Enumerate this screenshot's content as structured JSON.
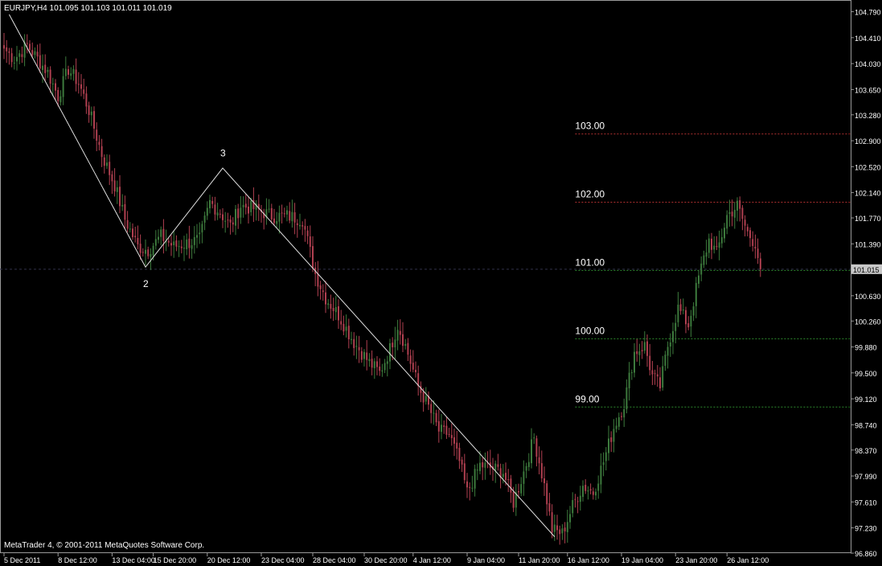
{
  "window": {
    "symbol_header": "EURJPY,H4  101.095 101.103 101.011 101.019",
    "copyright": "MetaTrader 4, © 2001-2011 MetaQuotes Software Corp."
  },
  "colors": {
    "background": "#000000",
    "frame": "#9a9a9a",
    "bull": "#3d7a3d",
    "bear": "#b04050",
    "text": "#ffffff",
    "level_red": "#b03030",
    "level_green": "#2e8b2e",
    "grid_dash": "#30304a",
    "price_tag_bg": "#c8c8c8",
    "zigzag": "#e0e0e0"
  },
  "chart_data": {
    "type": "candlestick",
    "timeframe": "H4",
    "symbol": "EURJPY",
    "ylim": [
      96.86,
      104.95
    ],
    "y_ticks": [
      "104.790",
      "104.410",
      "104.030",
      "103.650",
      "103.280",
      "102.900",
      "102.520",
      "102.140",
      "101.770",
      "101.390",
      "101.015",
      "100.630",
      "100.260",
      "99.880",
      "99.500",
      "99.120",
      "98.740",
      "98.370",
      "97.990",
      "97.610",
      "97.230",
      "96.860"
    ],
    "x_ticks": [
      {
        "label": "5 Dec 2011",
        "i": 0
      },
      {
        "label": "8 Dec 12:00",
        "i": 21
      },
      {
        "label": "13 Dec 04:00",
        "i": 42
      },
      {
        "label": "15 Dec 20:00",
        "i": 58
      },
      {
        "label": "20 Dec 12:00",
        "i": 79
      },
      {
        "label": "23 Dec 04:00",
        "i": 100
      },
      {
        "label": "28 Dec 04:00",
        "i": 120
      },
      {
        "label": "30 Dec 20:00",
        "i": 140
      },
      {
        "label": "4 Jan 12:00",
        "i": 159
      },
      {
        "label": "9 Jan 04:00",
        "i": 180
      },
      {
        "label": "11 Jan 20:00",
        "i": 200
      },
      {
        "label": "16 Jan 12:00",
        "i": 219
      },
      {
        "label": "19 Jan 04:00",
        "i": 240
      },
      {
        "label": "23 Jan 20:00",
        "i": 261
      },
      {
        "label": "26 Jan 12:00",
        "i": 281
      }
    ],
    "last_price": "101.015",
    "last_price_value": 101.019,
    "levels": [
      {
        "label": "103.00",
        "value": 103.0,
        "color": "red"
      },
      {
        "label": "102.00",
        "value": 102.0,
        "color": "red"
      },
      {
        "label": "101.00",
        "value": 101.0,
        "color": "green"
      },
      {
        "label": "100.00",
        "value": 100.0,
        "color": "green"
      },
      {
        "label": "99.00",
        "value": 99.0,
        "color": "green"
      }
    ],
    "levels_start_index": 222,
    "zigzag": [
      {
        "i": 2,
        "price": 104.75
      },
      {
        "i": 55,
        "price": 101.05
      },
      {
        "i": 85,
        "price": 102.5
      },
      {
        "i": 214,
        "price": 97.1
      }
    ],
    "wave_labels": [
      {
        "text": "2",
        "i": 55,
        "price": 100.85,
        "pos": "below"
      },
      {
        "text": "3",
        "i": 85,
        "price": 102.6,
        "pos": "above"
      }
    ],
    "anchors": [
      {
        "i": 0,
        "p": 104.25
      },
      {
        "i": 4,
        "p": 104.1
      },
      {
        "i": 9,
        "p": 104.3
      },
      {
        "i": 11,
        "p": 104.2
      },
      {
        "i": 17,
        "p": 103.9
      },
      {
        "i": 21,
        "p": 103.55
      },
      {
        "i": 25,
        "p": 103.95
      },
      {
        "i": 29,
        "p": 103.75
      },
      {
        "i": 33,
        "p": 103.35
      },
      {
        "i": 38,
        "p": 102.7
      },
      {
        "i": 43,
        "p": 102.25
      },
      {
        "i": 47,
        "p": 101.75
      },
      {
        "i": 52,
        "p": 101.35
      },
      {
        "i": 56,
        "p": 101.3
      },
      {
        "i": 61,
        "p": 101.5
      },
      {
        "i": 66,
        "p": 101.35
      },
      {
        "i": 71,
        "p": 101.4
      },
      {
        "i": 76,
        "p": 101.45
      },
      {
        "i": 80,
        "p": 102.0
      },
      {
        "i": 84,
        "p": 101.85
      },
      {
        "i": 88,
        "p": 101.65
      },
      {
        "i": 92,
        "p": 101.95
      },
      {
        "i": 98,
        "p": 101.9
      },
      {
        "i": 104,
        "p": 101.8
      },
      {
        "i": 110,
        "p": 101.8
      },
      {
        "i": 116,
        "p": 101.75
      },
      {
        "i": 121,
        "p": 100.95
      },
      {
        "i": 125,
        "p": 100.6
      },
      {
        "i": 130,
        "p": 100.35
      },
      {
        "i": 136,
        "p": 99.95
      },
      {
        "i": 142,
        "p": 99.65
      },
      {
        "i": 146,
        "p": 99.5
      },
      {
        "i": 150,
        "p": 99.85
      },
      {
        "i": 153,
        "p": 100.2
      },
      {
        "i": 156,
        "p": 99.9
      },
      {
        "i": 161,
        "p": 99.3
      },
      {
        "i": 165,
        "p": 99.0
      },
      {
        "i": 169,
        "p": 98.65
      },
      {
        "i": 173,
        "p": 98.6
      },
      {
        "i": 177,
        "p": 98.2
      },
      {
        "i": 180,
        "p": 97.75
      },
      {
        "i": 185,
        "p": 98.15
      },
      {
        "i": 190,
        "p": 98.1
      },
      {
        "i": 194,
        "p": 98.05
      },
      {
        "i": 198,
        "p": 97.6
      },
      {
        "i": 202,
        "p": 98.05
      },
      {
        "i": 206,
        "p": 98.55
      },
      {
        "i": 210,
        "p": 97.85
      },
      {
        "i": 213,
        "p": 97.2
      },
      {
        "i": 217,
        "p": 97.15
      },
      {
        "i": 221,
        "p": 97.55
      },
      {
        "i": 225,
        "p": 97.85
      },
      {
        "i": 229,
        "p": 97.75
      },
      {
        "i": 233,
        "p": 98.2
      },
      {
        "i": 237,
        "p": 98.7
      },
      {
        "i": 241,
        "p": 99.05
      },
      {
        "i": 245,
        "p": 99.8
      },
      {
        "i": 249,
        "p": 99.9
      },
      {
        "i": 252,
        "p": 99.45
      },
      {
        "i": 255,
        "p": 99.3
      },
      {
        "i": 258,
        "p": 99.9
      },
      {
        "i": 262,
        "p": 100.45
      },
      {
        "i": 266,
        "p": 100.2
      },
      {
        "i": 270,
        "p": 100.9
      },
      {
        "i": 274,
        "p": 101.45
      },
      {
        "i": 277,
        "p": 101.25
      },
      {
        "i": 281,
        "p": 101.8
      },
      {
        "i": 285,
        "p": 101.95
      },
      {
        "i": 289,
        "p": 101.55
      },
      {
        "i": 292,
        "p": 101.4
      },
      {
        "i": 294,
        "p": 101.019
      }
    ],
    "candle_count": 295
  }
}
